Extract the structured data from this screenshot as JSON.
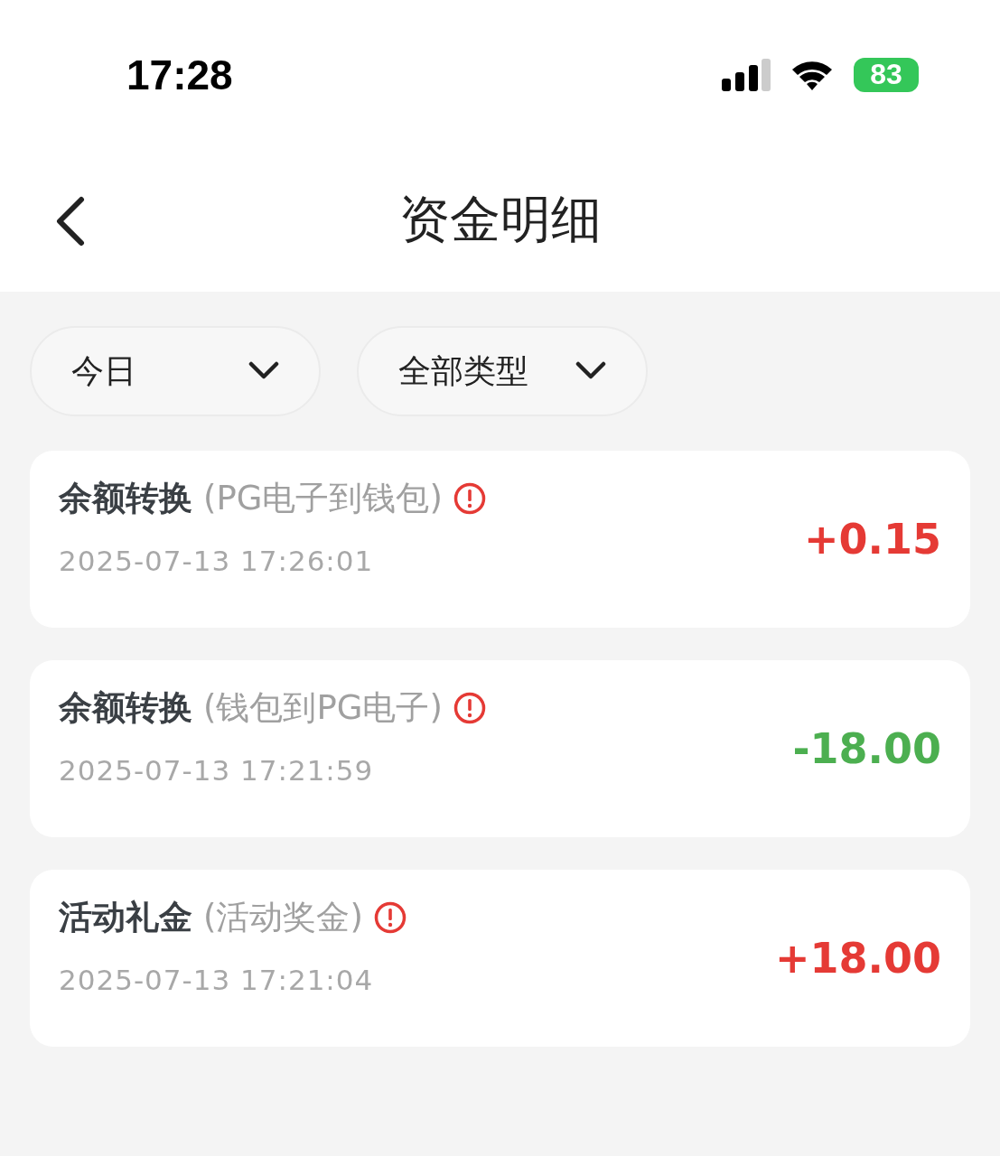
{
  "status_bar": {
    "time": "17:28",
    "battery": "83"
  },
  "header": {
    "title": "资金明细"
  },
  "filters": [
    {
      "label": "今日"
    },
    {
      "label": "全部类型"
    }
  ],
  "records": [
    {
      "title": "余额转换",
      "detail": "(PG电子到钱包)",
      "time": "2025-07-13 17:26:01",
      "amount": "+0.15",
      "kind": "income"
    },
    {
      "title": "余额转换",
      "detail": "(钱包到PG电子)",
      "time": "2025-07-13 17:21:59",
      "amount": "-18.00",
      "kind": "expense"
    },
    {
      "title": "活动礼金",
      "detail": "(活动奖金)",
      "time": "2025-07-13 17:21:04",
      "amount": "+18.00",
      "kind": "income"
    }
  ]
}
